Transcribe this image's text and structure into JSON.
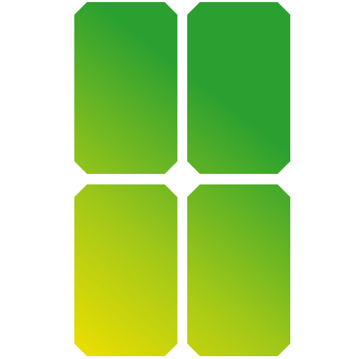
{
  "icon": {
    "name": "four-tiles-grid-icon",
    "shape": "octagon-tile",
    "tile_count": 4,
    "gradient": {
      "start_color": "#F0E000",
      "mid_color": "#A2C818",
      "end_color": "#2AA030"
    }
  }
}
